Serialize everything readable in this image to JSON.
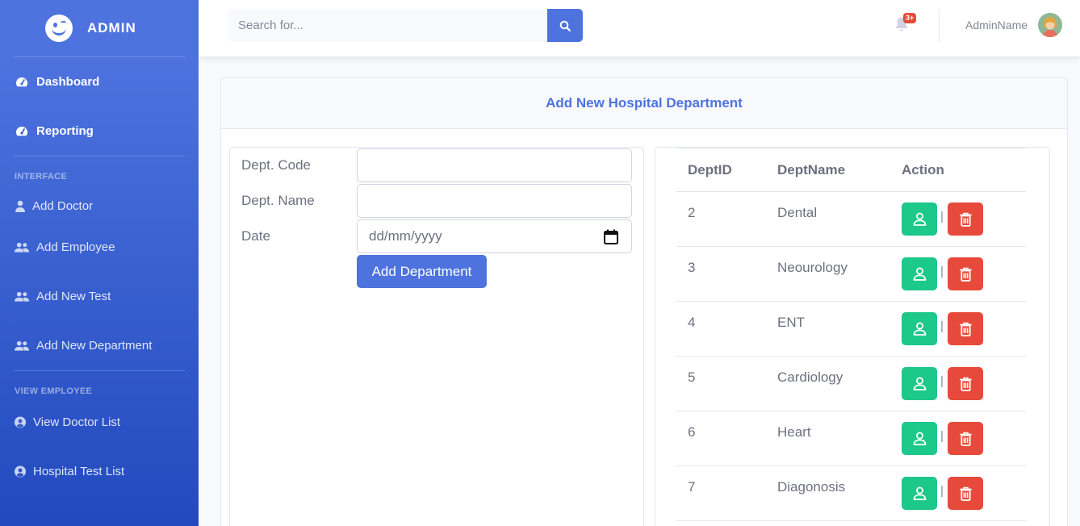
{
  "brand": {
    "title": "ADMIN"
  },
  "sidebar": {
    "top_items": [
      {
        "label": "Dashboard",
        "icon": "tachometer-icon"
      },
      {
        "label": "Reporting",
        "icon": "tachometer-icon"
      }
    ],
    "interface_heading": "INTERFACE",
    "interface_items": [
      {
        "label": "Add Doctor",
        "icon": "user-doctor-icon"
      },
      {
        "label": "Add Employee",
        "icon": "users-icon"
      },
      {
        "label": "Add New Test",
        "icon": "users-icon"
      },
      {
        "label": "Add New Department",
        "icon": "users-icon"
      }
    ],
    "employee_heading": "VIEW EMPLOYEE",
    "employee_items": [
      {
        "label": "View Doctor List",
        "icon": "user-circle-icon"
      },
      {
        "label": "Hospital Test List",
        "icon": "user-circle-icon"
      }
    ]
  },
  "topbar": {
    "search_placeholder": "Search for...",
    "alerts_badge": "3+",
    "username": "AdminName"
  },
  "card": {
    "title": "Add New Hospital Department"
  },
  "form": {
    "code_label": "Dept. Code",
    "code_value": "",
    "name_label": "Dept. Name",
    "name_value": "",
    "date_label": "Date",
    "date_placeholder": "dd/mm/yyyy",
    "submit_label": "Add Department"
  },
  "table": {
    "headers": [
      "DeptID",
      "DeptName",
      "Action"
    ],
    "separator": "|",
    "rows": [
      {
        "id": "2",
        "name": "Dental"
      },
      {
        "id": "3",
        "name": "Neourology"
      },
      {
        "id": "4",
        "name": "ENT"
      },
      {
        "id": "5",
        "name": "Cardiology"
      },
      {
        "id": "6",
        "name": "Heart"
      },
      {
        "id": "7",
        "name": "Diagonosis"
      }
    ]
  },
  "colors": {
    "primary": "#4e73df",
    "success": "#1cc88a",
    "danger": "#e74a3b"
  }
}
